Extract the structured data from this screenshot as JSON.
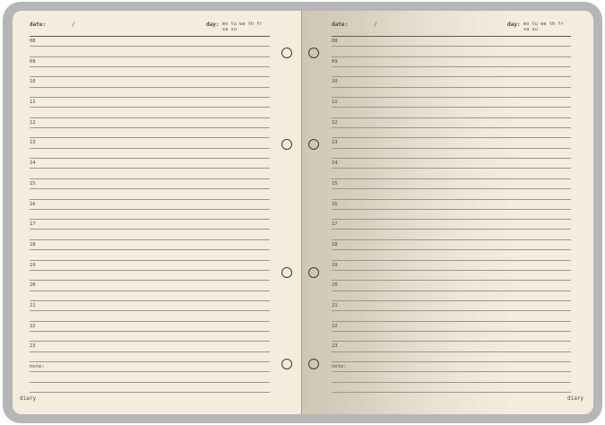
{
  "left_page": {
    "date_label": "date:",
    "date_separator": "/",
    "day_label": "day:",
    "weekdays": "mo tu we th fr sa su",
    "hours": [
      "08",
      "09",
      "10",
      "11",
      "12",
      "13",
      "14",
      "15",
      "16",
      "17",
      "18",
      "19",
      "20",
      "21",
      "22",
      "23"
    ],
    "note_label": "note:",
    "footer": "diary"
  },
  "right_page": {
    "date_label": "date:",
    "date_separator": "/",
    "day_label": "day:",
    "weekdays": "mo tu we th fr sa su",
    "hours": [
      "08",
      "09",
      "10",
      "11",
      "12",
      "13",
      "14",
      "15",
      "16",
      "17",
      "18",
      "19",
      "20",
      "21",
      "22",
      "23"
    ],
    "note_label": "note:",
    "footer": "diary"
  },
  "colors": {
    "cover": "#b5b6b8",
    "paper": "#f4ecdc",
    "ink": "#4a4744",
    "rule": "#9c978e"
  }
}
